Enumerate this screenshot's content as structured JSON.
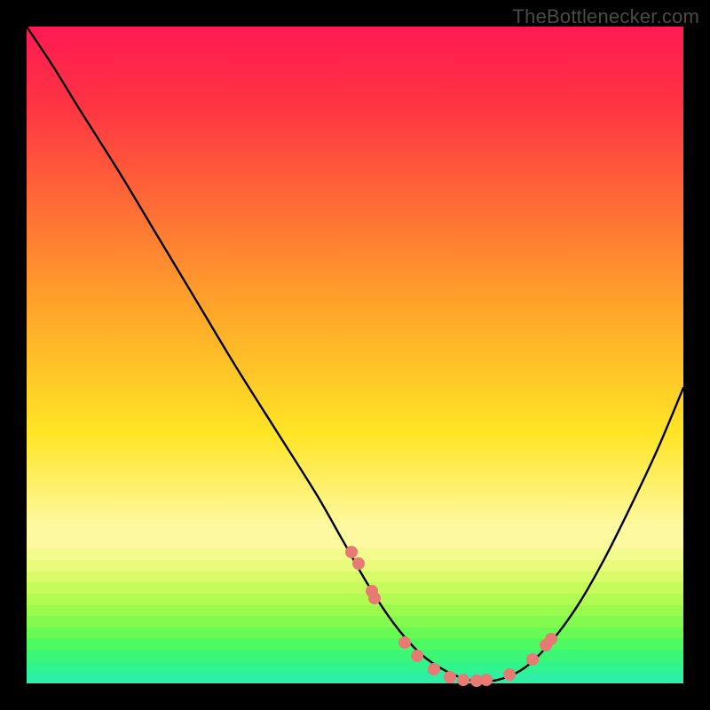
{
  "watermark": "TheBottlenecker.com",
  "colors": {
    "top": "#ff1a53",
    "red": "#ff3443",
    "orange": "#ffa22a",
    "yellow": "#ffe525",
    "paleyellow": "#fdf9a0",
    "dot": "#e77a72",
    "curve": "#000000",
    "green_bands": [
      "#f4fb8d",
      "#e9fb7b",
      "#d9fb6a",
      "#c7fb5c",
      "#b2fb52",
      "#9bfb4d",
      "#82fb4e",
      "#68fa55",
      "#4ff962",
      "#3cf775",
      "#30f48c",
      "#2df0a6"
    ]
  },
  "chart_data": {
    "type": "line",
    "title": "",
    "xlabel": "",
    "ylabel": "",
    "xlim": [
      0,
      100
    ],
    "ylim": [
      0,
      100
    ],
    "series": [
      {
        "name": "curve",
        "x": [
          0,
          4,
          8,
          14,
          20,
          26,
          32,
          38,
          44,
          48,
          52,
          56,
          60,
          64,
          68,
          72,
          76,
          80,
          84,
          88,
          92,
          96,
          100
        ],
        "y": [
          100,
          94,
          87.5,
          78,
          68,
          58,
          48,
          38.5,
          29,
          22,
          15,
          9,
          4.5,
          1.8,
          0.4,
          0.6,
          2.5,
          6.5,
          12,
          19,
          27,
          35.5,
          45
        ]
      }
    ],
    "markers": {
      "name": "highlight-dots",
      "x": [
        49.5,
        50.5,
        52.5,
        53.0,
        57.5,
        59.5,
        62.0,
        64.5,
        66.5,
        68.5,
        70.0,
        73.5,
        77.0,
        79.0,
        79.8
      ],
      "y": [
        20.0,
        18.3,
        14.0,
        13.0,
        6.2,
        4.2,
        2.2,
        1.0,
        0.5,
        0.4,
        0.5,
        1.4,
        3.6,
        5.8,
        6.8
      ]
    }
  }
}
